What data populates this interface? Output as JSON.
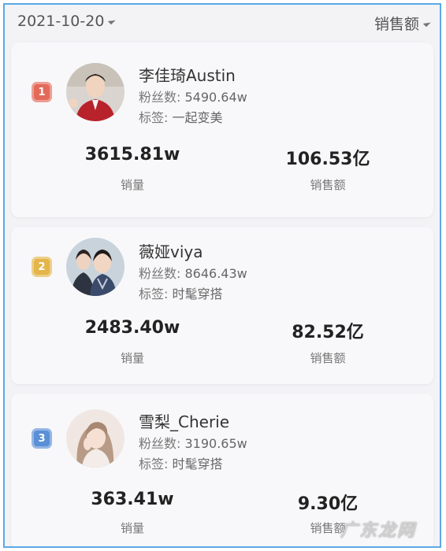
{
  "header": {
    "date": "2021-10-20",
    "sort_label": "销售额"
  },
  "colors": {
    "rank1": "#e36a5a",
    "rank2": "#e3b54a",
    "rank3": "#5b8fd6",
    "frame": "#5aa9e6"
  },
  "ranking": [
    {
      "rank": "1",
      "name": "李佳琦Austin",
      "fans_label": "粉丝数:",
      "fans": "5490.64w",
      "tag_label": "标签:",
      "tag": "一起变美",
      "sales_volume": "3615.81w",
      "sales_volume_label": "销量",
      "sales_amount": "106.53亿",
      "sales_amount_label": "销售额"
    },
    {
      "rank": "2",
      "name": "薇娅viya",
      "fans_label": "粉丝数:",
      "fans": "8646.43w",
      "tag_label": "标签:",
      "tag": "时髦穿搭",
      "sales_volume": "2483.40w",
      "sales_volume_label": "销量",
      "sales_amount": "82.52亿",
      "sales_amount_label": "销售额"
    },
    {
      "rank": "3",
      "name": "雪梨_Cherie",
      "fans_label": "粉丝数:",
      "fans": "3190.65w",
      "tag_label": "标签:",
      "tag": "时髦穿搭",
      "sales_volume": "363.41w",
      "sales_volume_label": "销量",
      "sales_amount": "9.30亿",
      "sales_amount_label": "销售额"
    }
  ],
  "watermark": "广东龙网"
}
